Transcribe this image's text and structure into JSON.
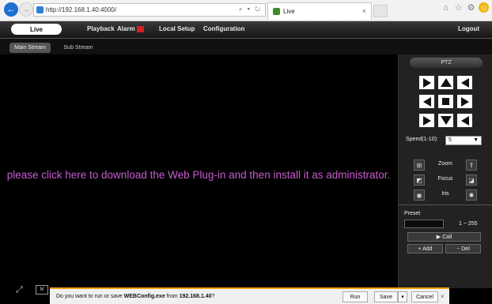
{
  "browser": {
    "url": "http://192.168.1.40:4000/",
    "address_controls": "⌕ ▾ ↻",
    "tab_title": "Live",
    "tab_close": "×"
  },
  "nav": {
    "live": "Live",
    "playback": "Playback",
    "alarm": "Alarm",
    "local_setup": "Local Setup",
    "configuration": "Configuration",
    "logout": "Logout"
  },
  "streams": {
    "main": "Main Stream",
    "sub": "Sub Stream"
  },
  "video": {
    "plugin_message": "please click here to download the Web Plug-in and then install it as administrator."
  },
  "ptz": {
    "title": "PTZ",
    "speed_label": "Speed(1-10):",
    "speed_value": "5",
    "zoom": "Zoom",
    "focus": "Focus",
    "iris": "Iris",
    "preset_label": "Preset",
    "preset_range": "1 ~ 255",
    "call": "▶ Call",
    "add": "+ Add",
    "del": "− Del"
  },
  "bottom": {
    "mode_label": "M"
  },
  "download": {
    "text_prefix": "Do you want to run or save ",
    "file_name": "WEBConfig.exe",
    "text_middle": " from ",
    "host": "192.168.1.40",
    "text_suffix": "?",
    "run": "Run",
    "save": "Save",
    "save_arrow": "▾",
    "cancel": "Cancel",
    "close": "×"
  }
}
